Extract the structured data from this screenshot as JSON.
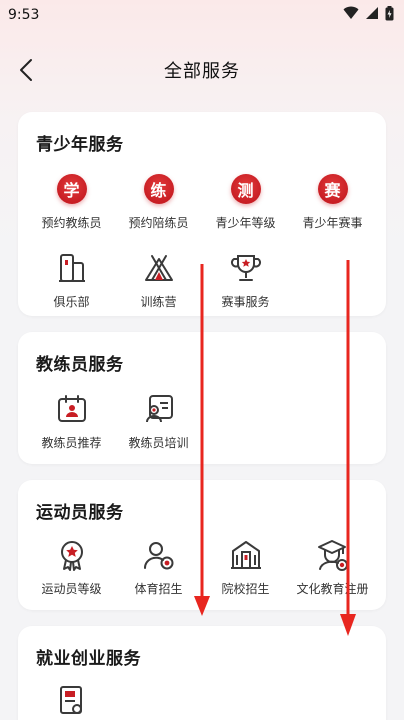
{
  "status": {
    "time": "9:53"
  },
  "nav": {
    "title": "全部服务"
  },
  "colors": {
    "accent": "#c81e24",
    "icon_outline": "#3a3a3a"
  },
  "sections": [
    {
      "title": "青少年服务",
      "items": [
        {
          "label": "预约教练员",
          "badge": "学"
        },
        {
          "label": "预约陪练员",
          "badge": "练"
        },
        {
          "label": "青少年等级",
          "badge": "测"
        },
        {
          "label": "青少年赛事",
          "badge": "赛"
        },
        {
          "label": "俱乐部",
          "icon": "building-icon"
        },
        {
          "label": "训练营",
          "icon": "tent-icon"
        },
        {
          "label": "赛事服务",
          "icon": "trophy-icon"
        }
      ]
    },
    {
      "title": "教练员服务",
      "items": [
        {
          "label": "教练员推荐",
          "icon": "calendar-icon"
        },
        {
          "label": "教练员培训",
          "icon": "trainer-icon"
        }
      ]
    },
    {
      "title": "运动员服务",
      "items": [
        {
          "label": "运动员等级",
          "icon": "medal-icon"
        },
        {
          "label": "体育招生",
          "icon": "user-add-icon"
        },
        {
          "label": "院校招生",
          "icon": "school-icon"
        },
        {
          "label": "文化教育注册",
          "icon": "graduate-icon"
        }
      ]
    },
    {
      "title": "就业创业服务",
      "items": [
        {
          "label": "",
          "icon": "certificate-icon"
        }
      ]
    }
  ]
}
